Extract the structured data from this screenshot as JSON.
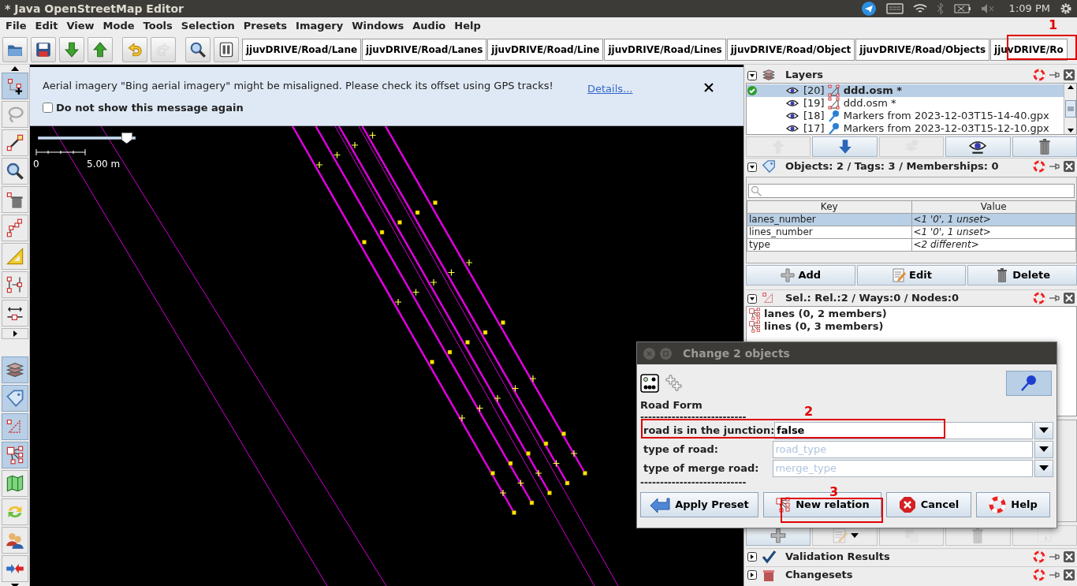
{
  "window": {
    "title": "* Java OpenStreetMap Editor"
  },
  "system_tray": {
    "time": "1:09 PM"
  },
  "menu": [
    "File",
    "Edit",
    "View",
    "Mode",
    "Tools",
    "Selection",
    "Presets",
    "Imagery",
    "Windows",
    "Audio",
    "Help"
  ],
  "toolbar": {
    "tools": [
      {
        "kind": "open",
        "disabled": false
      },
      {
        "kind": "save",
        "disabled": false
      },
      {
        "kind": "download",
        "disabled": false
      },
      {
        "kind": "upload",
        "disabled": false
      },
      {
        "kind": "undo",
        "disabled": false
      },
      {
        "kind": "redo",
        "disabled": true
      },
      {
        "kind": "zoom",
        "disabled": false
      },
      {
        "kind": "preferences",
        "disabled": false
      }
    ],
    "presets": [
      "jjuvDRIVE/Road/Lane",
      "jjuvDRIVE/Road/Lanes",
      "jjuvDRIVE/Road/Line",
      "jjuvDRIVE/Road/Lines",
      "jjuvDRIVE/Road/Object",
      "jjuvDRIVE/Road/Objects",
      "jjuvDRIVE/Ro"
    ]
  },
  "mode_toolbar": {
    "modes": [
      {
        "kind": "select",
        "selected": true
      },
      {
        "kind": "lasso",
        "selected": false
      },
      {
        "kind": "draw",
        "selected": false
      },
      {
        "kind": "zoom",
        "selected": false
      },
      {
        "kind": "delete",
        "selected": false
      },
      {
        "kind": "improve",
        "selected": false
      },
      {
        "kind": "measure",
        "selected": false
      },
      {
        "kind": "combine",
        "selected": false
      },
      {
        "kind": "parallel",
        "selected": false
      }
    ],
    "dialogs": [
      {
        "kind": "layers",
        "selected": true
      },
      {
        "kind": "tags",
        "selected": true
      },
      {
        "kind": "selection",
        "selected": true
      },
      {
        "kind": "relations",
        "selected": true
      },
      {
        "kind": "map",
        "selected": false
      },
      {
        "kind": "sync",
        "selected": false
      },
      {
        "kind": "users",
        "selected": false
      },
      {
        "kind": "conflict",
        "selected": false
      }
    ]
  },
  "notification": {
    "message": "Aerial imagery \"Bing aerial imagery\" might be misaligned. Please check its offset using GPS tracks!",
    "link": "Details...",
    "checkbox": {
      "label": "Do not show this message again",
      "checked": false
    }
  },
  "map": {
    "zoom_slider": {
      "level": 0.9
    },
    "scale_bar": {
      "start": "0",
      "length": "5.00 m"
    }
  },
  "layers_panel": {
    "title": "Layers",
    "expanded": true,
    "layers": [
      {
        "active": true,
        "visible": true,
        "number": "[20]",
        "kind": "osm",
        "name": "ddd.osm *",
        "selected": true
      },
      {
        "active": false,
        "visible": true,
        "number": "[19]",
        "kind": "osm",
        "name": "ddd.osm *",
        "selected": false
      },
      {
        "active": false,
        "visible": true,
        "number": "[18]",
        "kind": "markers",
        "name": "Markers from 2023-12-03T15-14-40.gpx",
        "selected": false
      },
      {
        "active": false,
        "visible": true,
        "number": "[17]",
        "kind": "markers",
        "name": "Markers from 2023-12-03T15-12-10.gpx",
        "selected": false
      }
    ],
    "buttons": [
      {
        "kind": "up",
        "disabled": true
      },
      {
        "kind": "down",
        "disabled": false
      },
      {
        "kind": "merge",
        "disabled": true
      },
      {
        "kind": "visibility",
        "disabled": false
      },
      {
        "kind": "delete",
        "disabled": false
      }
    ]
  },
  "tags_panel": {
    "title": "Objects: 2 / Tags: 3 / Memberships: 0",
    "expanded": true,
    "columns": [
      "Key",
      "Value"
    ],
    "rows": [
      {
        "key": "lanes_number",
        "value": "<1 '0', 1 unset>",
        "selected": true
      },
      {
        "key": "lines_number",
        "value": "<1 '0', 1 unset>",
        "selected": false
      },
      {
        "key": "type",
        "value": "<2 different>",
        "selected": false
      }
    ],
    "buttons": [
      {
        "kind": "add",
        "label": "Add"
      },
      {
        "kind": "edit",
        "label": "Edit"
      },
      {
        "kind": "delete",
        "label": "Delete"
      }
    ]
  },
  "selection_panel": {
    "title": "Sel.: Rel.:2 / Ways:0 / Nodes:0",
    "expanded": true,
    "items": [
      "lanes (0, 2 members)",
      "lines (0, 3 members)"
    ]
  },
  "relation_buttons": [
    {
      "kind": "add",
      "disabled": false
    },
    {
      "kind": "edit",
      "disabled": true
    },
    {
      "kind": "duplicate",
      "disabled": true
    },
    {
      "kind": "delete",
      "disabled": true
    },
    {
      "kind": "select",
      "disabled": true
    }
  ],
  "collapsed_panels": [
    {
      "kind": "validation",
      "title": "Validation Results",
      "expanded": false
    },
    {
      "kind": "changesets",
      "title": "Changesets",
      "expanded": false
    }
  ],
  "dialog": {
    "title": "Change 2 objects",
    "form_title": "Road Form",
    "separator_top": "---------------------------",
    "separator_bottom": "---------------------------",
    "fields": [
      {
        "label": "road is in the junction:",
        "value": "false"
      },
      {
        "label": "type of road:",
        "placeholder": "road_type"
      },
      {
        "label": "type of  merge road:",
        "placeholder": "merge_type"
      }
    ],
    "buttons": [
      {
        "kind": "apply",
        "label": "Apply Preset"
      },
      {
        "kind": "relation",
        "label": "New relation"
      },
      {
        "kind": "cancel",
        "label": "Cancel"
      },
      {
        "kind": "help",
        "label": "Help"
      }
    ]
  },
  "annotations": [
    "1",
    "2",
    "3"
  ]
}
